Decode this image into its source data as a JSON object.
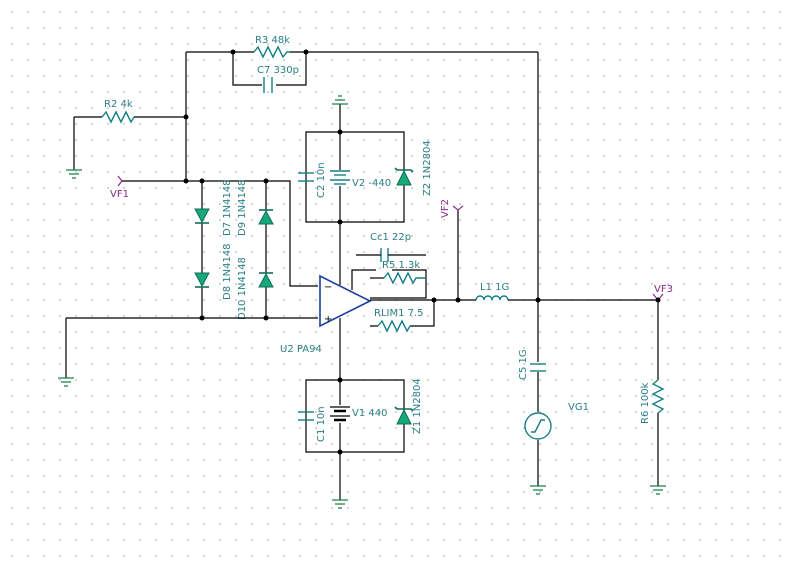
{
  "components": {
    "r3": "R3 48k",
    "c7": "C7 330p",
    "r2": "R2 4k",
    "vf1": "VF1",
    "d8": "D8 1N4148",
    "d7": "D7 1N4148",
    "d10": "D10 1N4148",
    "d9": "D9 1N4148",
    "c2": "C2 10n",
    "v2": "V2 -440",
    "z2": "Z2 1N2804",
    "vf2": "VF2",
    "cc1": "Cc1 22p",
    "r5": "R5 1.3k",
    "l1": "L1 1G",
    "vf3": "VF3",
    "rlim1": "RLIM1 7.5",
    "u2": "U2 PA94",
    "c5": "C5 1G",
    "vg1": "VG1",
    "r6": "R6 100k",
    "c1": "C1 10n",
    "v1": "V1 440",
    "z1": "Z1 1N2804"
  },
  "symbols": {
    "minus": "−",
    "plus": "+"
  },
  "colors": {
    "wire": "#000000",
    "component": "#157f86",
    "diode": "#14a87a",
    "opamp": "#1a3fa0",
    "ground": "#0e7a40",
    "net_label": "#8a2a8a"
  }
}
